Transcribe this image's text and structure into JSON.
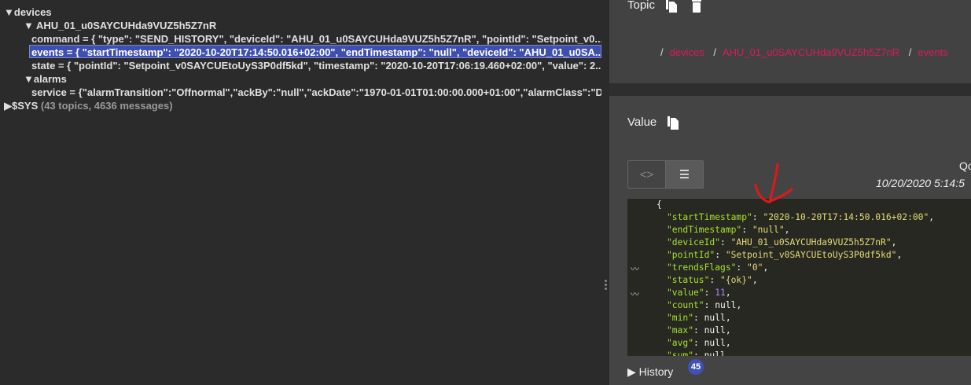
{
  "tree": {
    "devices": "devices",
    "device": "AHU_01_u0SAYCUHda9VUZ5h5Z7nR",
    "command": "command = { \"type\": \"SEND_HISTORY\", \"deviceId\": \"AHU_01_u0SAYCUHda9VUZ5h5Z7nR\", \"pointId\": \"Setpoint_v0...",
    "events": "events = { \"startTimestamp\": \"2020-10-20T17:14:50.016+02:00\", \"endTimestamp\": \"null\", \"deviceId\": \"AHU_01_u0SA...",
    "state": "state = { \"pointId\": \"Setpoint_v0SAYCUEtoUyS3P0df5kd\", \"timestamp\": \"2020-10-20T17:06:19.460+02:00\", \"value\": 2...",
    "alarms": "alarms",
    "service": "service = {\"alarmTransition\":\"Offnormal\",\"ackBy\":\"null\",\"ackDate\":\"1970-01-01T01:00:00.000+01:00\",\"alarmClass\":\"D...",
    "sys": "$SYS",
    "sys_info": "(43 topics, 4636 messages)"
  },
  "topic": {
    "title": "Topic",
    "breadcrumb": [
      "devices",
      "AHU_01_u0SAYCUHda9VUZ5h5Z7nR",
      "events"
    ]
  },
  "value": {
    "title": "Value",
    "qos": "Qo",
    "timestamp": "10/20/2020 5:14:5",
    "lines": [
      {
        "k": "startTimestamp",
        "v": "\"2020-10-20T17:14:50.016+02:00\"",
        "t": "s"
      },
      {
        "k": "endTimestamp",
        "v": "\"null\"",
        "t": "s"
      },
      {
        "k": "deviceId",
        "v": "\"AHU_01_u0SAYCUHda9VUZ5h5Z7nR\"",
        "t": "s"
      },
      {
        "k": "pointId",
        "v": "\"Setpoint_v0SAYCUEtoUyS3P0df5kd\"",
        "t": "s"
      },
      {
        "k": "trendsFlags",
        "v": "\"0\"",
        "t": "s",
        "chart": true
      },
      {
        "k": "status",
        "v": "\"{ok}\"",
        "t": "s"
      },
      {
        "k": "value",
        "v": "11",
        "t": "n",
        "chart": true
      },
      {
        "k": "count",
        "v": "null",
        "t": "p"
      },
      {
        "k": "min",
        "v": "null",
        "t": "p"
      },
      {
        "k": "max",
        "v": "null",
        "t": "p"
      },
      {
        "k": "avg",
        "v": "null",
        "t": "p"
      },
      {
        "k": "sum",
        "v": "null",
        "t": "p"
      }
    ]
  },
  "history": {
    "label": "History",
    "count": "45"
  },
  "colors": {
    "accent": "#d81b60",
    "selection": "#3f4fb0",
    "badge": "#3f51b5",
    "annotation": "#e01818"
  }
}
